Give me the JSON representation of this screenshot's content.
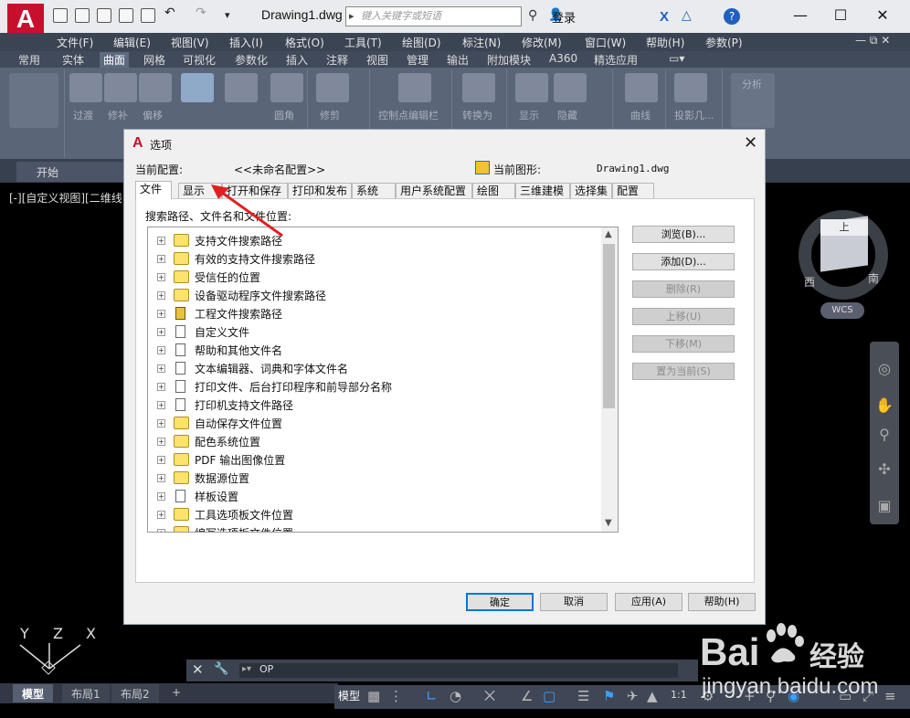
{
  "app": {
    "logo_letter": "A",
    "doc_title": "Drawing1.dwg",
    "search_placeholder": "键入关键字或短语",
    "login_label": "登录",
    "window_controls": [
      "—",
      "☐",
      "✕"
    ]
  },
  "menubar": [
    "文件(F)",
    "编辑(E)",
    "视图(V)",
    "插入(I)",
    "格式(O)",
    "工具(T)",
    "绘图(D)",
    "标注(N)",
    "修改(M)",
    "窗口(W)",
    "帮助(H)",
    "参数(P)"
  ],
  "ribbon_tabs": {
    "items": [
      "常用",
      "实体",
      "曲面",
      "网格",
      "可视化",
      "参数化",
      "插入",
      "注释",
      "视图",
      "管理",
      "输出",
      "附加模块",
      "A360",
      "精选应用"
    ],
    "active": "曲面"
  },
  "ribbon_labels": [
    "过渡",
    "修补",
    "偏移",
    "圆角",
    "修剪",
    "控制点编辑栏",
    "转换为",
    "显示",
    "隐藏",
    "曲线",
    "投影几...",
    "分析"
  ],
  "file_tabs": {
    "start": "开始"
  },
  "viewport_label": "[-][自定义视图][二维线",
  "viewcube": {
    "top": "上",
    "south": "南",
    "west": "西",
    "wcs": "WCS"
  },
  "ucs": {
    "y": "Y",
    "z": "Z",
    "x": "X"
  },
  "command_line": {
    "prompt": "OP"
  },
  "layout_tabs": [
    "模型",
    "布局1",
    "布局2",
    "+"
  ],
  "status": {
    "model": "模型",
    "scale": "1:1"
  },
  "dialog": {
    "title": "选项",
    "current_profile_label": "当前配置:",
    "current_profile_value": "<<未命名配置>>",
    "current_drawing_label": "当前图形:",
    "current_drawing_value": "Drawing1.dwg",
    "tabs": [
      "文件",
      "显示",
      "打开和保存",
      "打印和发布",
      "系统",
      "用户系统配置",
      "绘图",
      "三维建模",
      "选择集",
      "配置"
    ],
    "active_tab": "文件",
    "tree_label": "搜索路径、文件名和文件位置:",
    "tree_items": [
      {
        "label": "支持文件搜索路径",
        "icon": "folder-icon"
      },
      {
        "label": "有效的支持文件搜索路径",
        "icon": "folder-icon"
      },
      {
        "label": "受信任的位置",
        "icon": "folder-icon"
      },
      {
        "label": "设备驱动程序文件搜索路径",
        "icon": "folder-icon"
      },
      {
        "label": "工程文件搜索路径",
        "icon": "project-icon"
      },
      {
        "label": "自定义文件",
        "icon": "file-icon"
      },
      {
        "label": "帮助和其他文件名",
        "icon": "file-icon"
      },
      {
        "label": "文本编辑器、词典和字体文件名",
        "icon": "file-icon"
      },
      {
        "label": "打印文件、后台打印程序和前导部分名称",
        "icon": "file-icon"
      },
      {
        "label": "打印机支持文件路径",
        "icon": "file-icon"
      },
      {
        "label": "自动保存文件位置",
        "icon": "folder-icon"
      },
      {
        "label": "配色系统位置",
        "icon": "folder-icon"
      },
      {
        "label": "PDF 输出图像位置",
        "icon": "folder-icon"
      },
      {
        "label": "数据源位置",
        "icon": "folder-icon"
      },
      {
        "label": "样板设置",
        "icon": "file-icon"
      },
      {
        "label": "工具选项板文件位置",
        "icon": "folder-icon"
      },
      {
        "label": "编写选项板文件位置",
        "icon": "folder-icon"
      }
    ],
    "side_buttons": [
      {
        "label": "浏览(B)...",
        "enabled": true
      },
      {
        "label": "添加(D)...",
        "enabled": true
      },
      {
        "label": "删除(R)",
        "enabled": false
      },
      {
        "label": "上移(U)",
        "enabled": false
      },
      {
        "label": "下移(M)",
        "enabled": false
      },
      {
        "label": "置为当前(S)",
        "enabled": false
      }
    ],
    "buttons": {
      "ok": "确定",
      "cancel": "取消",
      "apply": "应用(A)",
      "help": "帮助(H)"
    }
  },
  "watermark": {
    "brand": "Bai",
    "brand_cn": "经验",
    "url": "jingyan.baidu.com"
  },
  "colors": {
    "accent_red": "#c8102e",
    "annotation_arrow": "#e02020",
    "focus_blue": "#0078d7"
  }
}
